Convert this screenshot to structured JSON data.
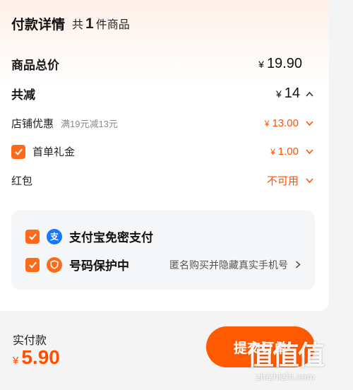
{
  "header": {
    "title": "付款详情",
    "count_prefix": "共",
    "count": "1",
    "count_suffix": "件商品"
  },
  "summary": {
    "total_label": "商品总价",
    "total_currency": "¥",
    "total_value": "19.90",
    "discount_label": "共减",
    "discount_currency": "¥",
    "discount_value": "14"
  },
  "discounts": {
    "store": {
      "label": "店铺优惠",
      "detail": "满19元减13元",
      "currency": "¥",
      "value": "13.00"
    },
    "first_order": {
      "label": "首单礼金",
      "currency": "¥",
      "value": "1.00",
      "checked": true
    },
    "red_packet": {
      "label": "红包",
      "status": "不可用"
    }
  },
  "options": {
    "alipay": {
      "label": "支付宝免密支付",
      "icon_char": "支",
      "checked": true
    },
    "privacy": {
      "label": "号码保护中",
      "note": "匿名购买并隐藏真实手机号",
      "checked": true
    }
  },
  "footer": {
    "label": "实付款",
    "currency": "¥",
    "value": "5.90",
    "submit_label": "提交订单"
  },
  "watermark": {
    "logo": "值值值",
    "site": "zhizhizhi.com"
  },
  "colors": {
    "accent": "#ff5000",
    "button": "#ff5a00",
    "checkbox": "#ff6a1a",
    "alipay_icon": "#1677ff",
    "privacy_icon": "#ff6a1a"
  }
}
